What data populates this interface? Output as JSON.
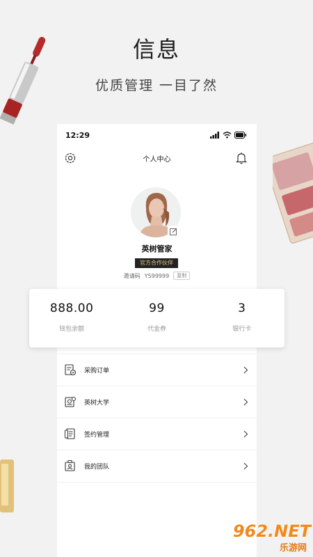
{
  "promo": {
    "headline": "信息",
    "subline": "优质管理 一目了然"
  },
  "status_bar": {
    "time": "12:29"
  },
  "header": {
    "title": "个人中心"
  },
  "profile": {
    "name": "英树管家",
    "badge": "官方合作伙伴",
    "invite_label": "邀请码",
    "invite_code": "YS99999",
    "copy_label": "复制"
  },
  "stats": [
    {
      "value": "888.00",
      "label": "钱包余额"
    },
    {
      "value": "99",
      "label": "代金券"
    },
    {
      "value": "3",
      "label": "银行卡"
    }
  ],
  "menu": [
    {
      "label": "采购订单",
      "icon": "purchase-order-icon"
    },
    {
      "label": "英树大学",
      "icon": "university-icon"
    },
    {
      "label": "签约管理",
      "icon": "contract-icon"
    },
    {
      "label": "我的团队",
      "icon": "team-icon"
    }
  ],
  "watermark": {
    "brand": "962.NET",
    "sub": "乐游网"
  },
  "colors": {
    "badge_bg": "#222222",
    "badge_text": "#e5c98a",
    "watermark": "#f08a1c"
  }
}
